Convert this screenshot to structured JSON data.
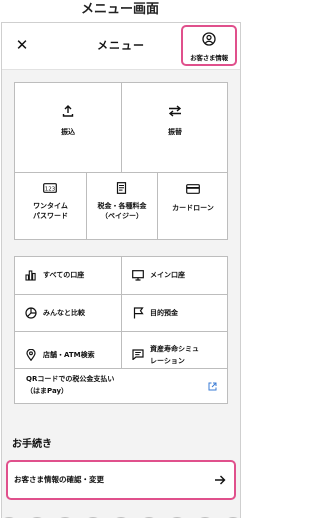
{
  "caption": "メニュー画面",
  "header": {
    "title": "メニュー",
    "customer_info_label": "お客さま情報"
  },
  "top_grid": {
    "transfer": "振込",
    "furikae": "振替",
    "onetime_line1": "ワンタイム",
    "onetime_line2": "パスワード",
    "tax_line1": "税金・各種料金",
    "tax_line2": "（ペイジー）",
    "cardloan": "カードローン"
  },
  "mid_grid": {
    "all_accounts": "すべての口座",
    "main_account": "メイン口座",
    "compare": "みんなと比較",
    "goal_savings": "目的預金",
    "branch_atm": "店舗・ATM検索",
    "asset_sim_line1": "資産寿命シミュ",
    "asset_sim_line2": "レーション"
  },
  "qr": {
    "line1": "QRコードでの税公金支払い",
    "line2": "（はまPay）"
  },
  "procedures": {
    "title": "お手続き",
    "customer_info_change": "お客さま情報の確認・変更"
  },
  "colors": {
    "highlight": "#e0508c",
    "background": "#f3f3f3",
    "border": "#bdbdbd",
    "link": "#3a7bd5"
  }
}
